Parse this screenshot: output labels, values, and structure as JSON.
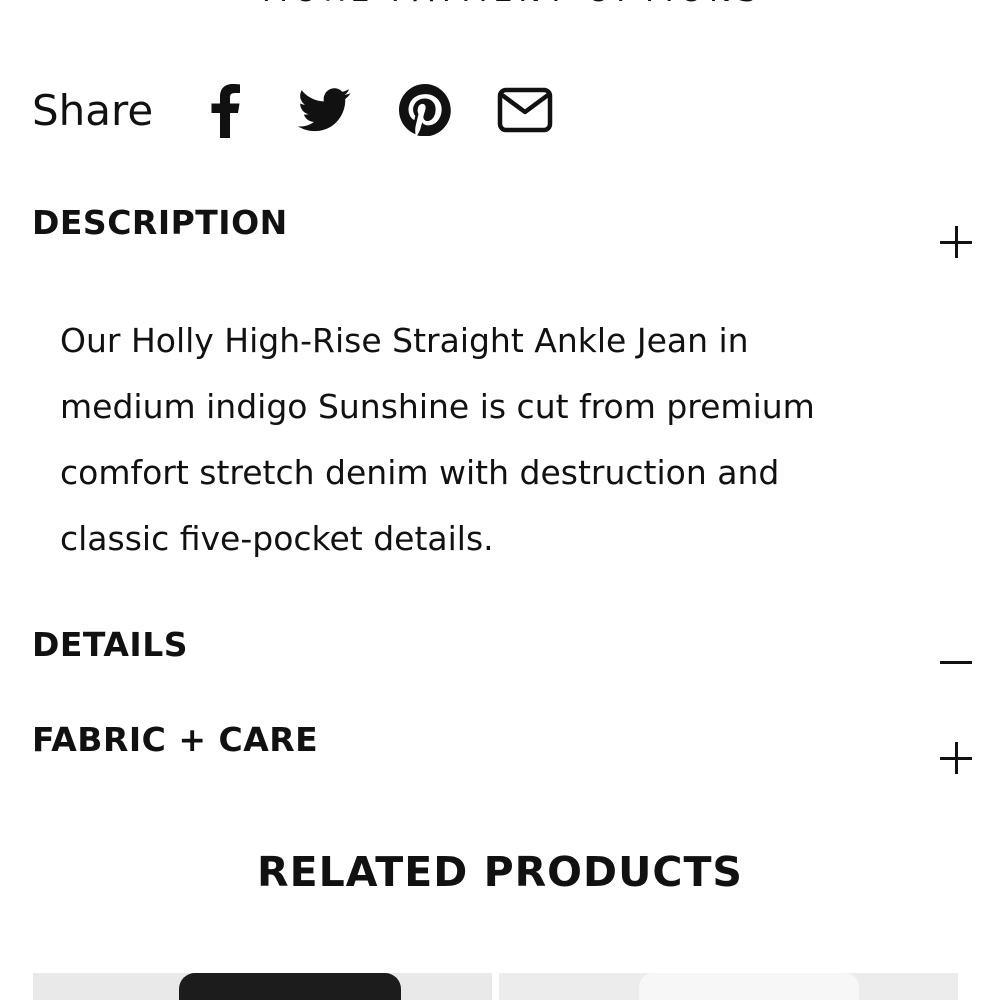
{
  "payment": {
    "more_options_label": "MORE PAYMENT OPTIONS"
  },
  "share": {
    "label": "Share",
    "icons": [
      "facebook-icon",
      "twitter-icon",
      "pinterest-icon",
      "email-icon"
    ]
  },
  "accordion": {
    "description": {
      "title": "DESCRIPTION",
      "toggle_symbol": "plus",
      "body": "Our Holly High-Rise Straight Ankle Jean in medium indigo Sunshine is cut from premium comfort stretch denim with destruction and classic five-pocket details."
    },
    "details": {
      "title": "DETAILS",
      "toggle_symbol": "minus"
    },
    "fabric_care": {
      "title": "FABRIC + CARE",
      "toggle_symbol": "plus"
    }
  },
  "related": {
    "title": "RELATED PRODUCTS",
    "product_count_visible": 2
  },
  "colors": {
    "text": "#111111",
    "background": "#ffffff",
    "card_background": "#e9e9e9"
  }
}
